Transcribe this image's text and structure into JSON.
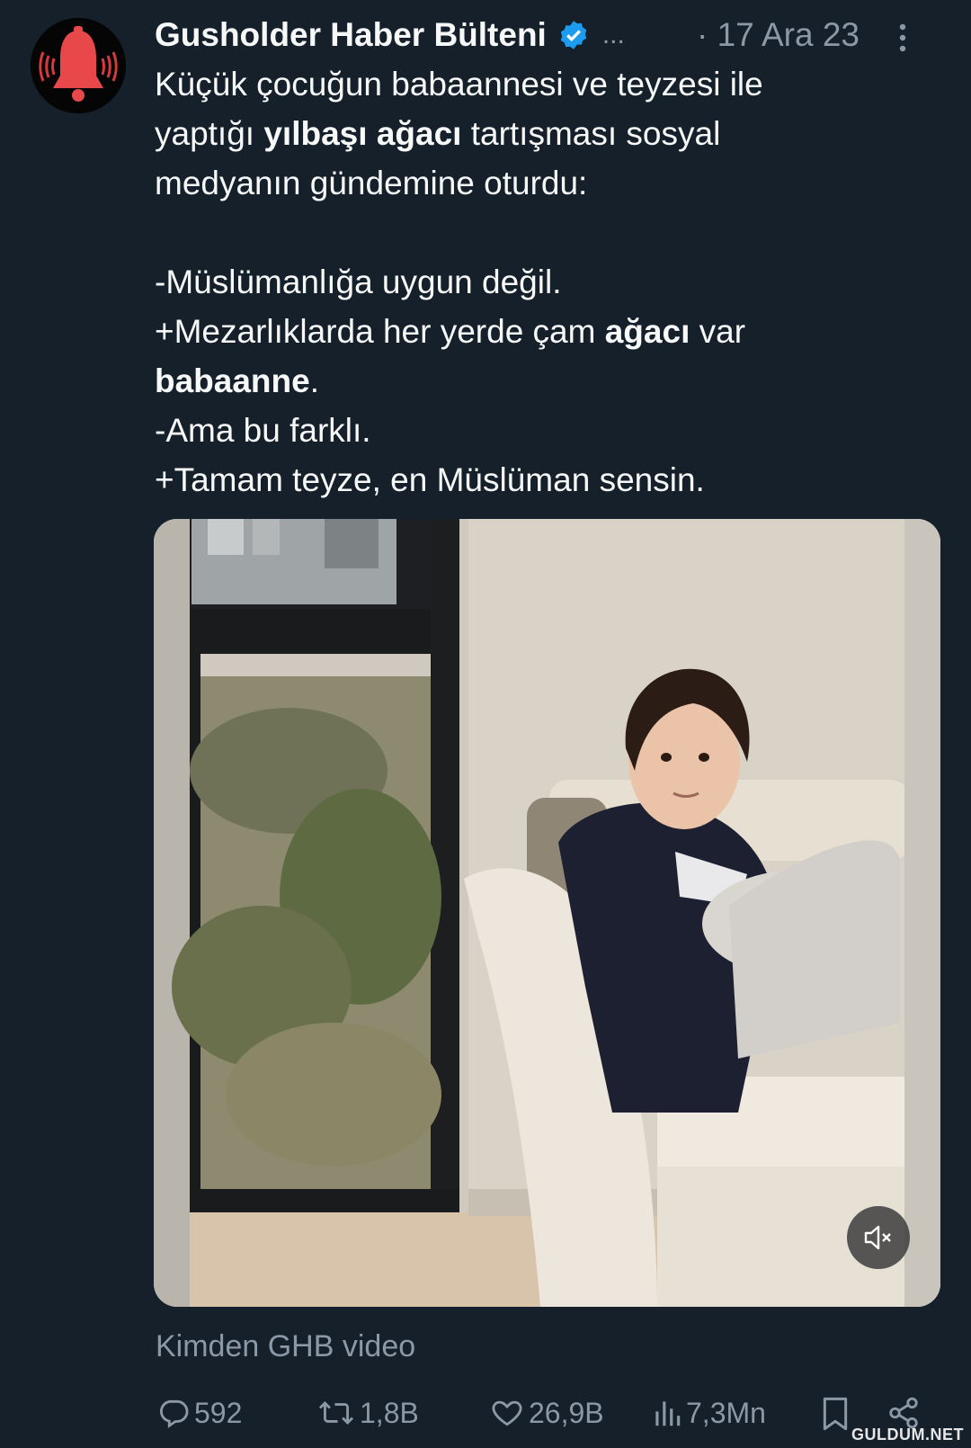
{
  "author": {
    "display_name": "Gusholder Haber Bülteni",
    "name_overflow": "...",
    "date": "· 17 Ara 23",
    "verified": true,
    "avatar_icon": "red-bell-icon",
    "brand_color": "#e8484a",
    "verified_color": "#1d9bf0"
  },
  "tweet": {
    "l1": "Küçük çocuğun babaannesi ve teyzesi ile",
    "l2a": "yaptığı ",
    "l2b": "yılbaşı ağacı",
    "l2c": " tartışması sosyal",
    "l3": "medyanın gündemine oturdu:",
    "l4": "-Müslümanlığa uygun değil.",
    "l5a": "+Mezarlıklarda her yerde çam ",
    "l5b": "ağacı",
    "l5c": " var",
    "l6a": "babaanne",
    "l6b": ".",
    "l7": "-Ama bu farklı.",
    "l8": "+Tamam teyze, en Müslüman sensin."
  },
  "media": {
    "type": "video",
    "description_icon": "video-thumbnail",
    "muted": true
  },
  "source": "Kimden GHB video",
  "actions": {
    "replies": "592",
    "retweets": "1,8B",
    "likes": "26,9B",
    "views": "7,3Mn"
  },
  "watermark": "GULDUM.NET"
}
